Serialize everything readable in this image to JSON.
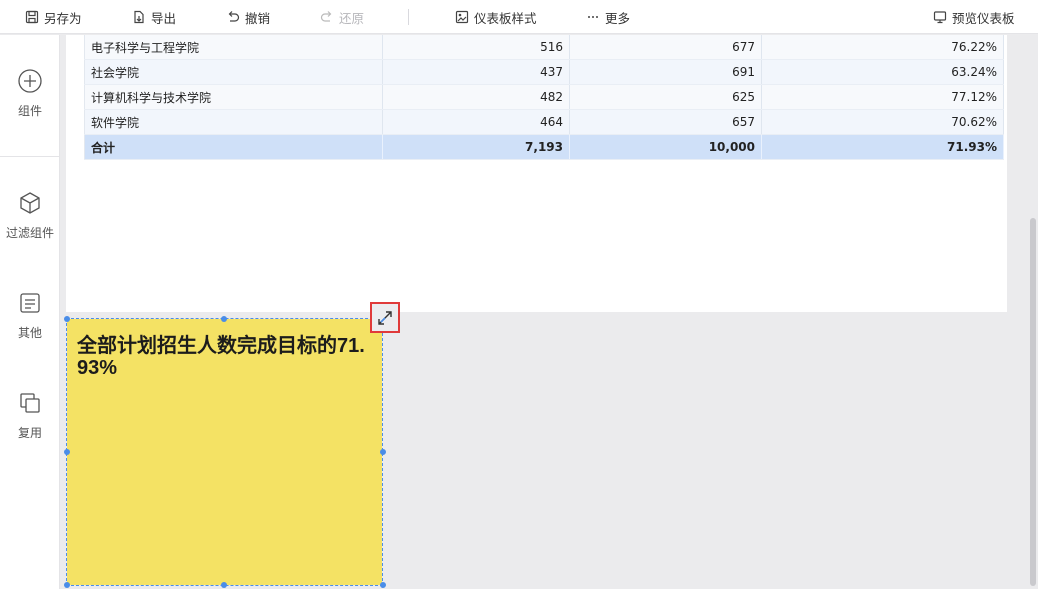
{
  "toolbar": {
    "save_as": "另存为",
    "export": "导出",
    "undo": "撤销",
    "redo": "还原",
    "dashboard_style": "仪表板样式",
    "more": "更多",
    "preview": "预览仪表板"
  },
  "left_panel": {
    "components": "组件",
    "filter_components": "过滤组件",
    "other": "其他",
    "reuse": "复用"
  },
  "table": {
    "rows": [
      {
        "name": "电子科学与工程学院",
        "a": "516",
        "b": "677",
        "c": "76.22%"
      },
      {
        "name": "社会学院",
        "a": "437",
        "b": "691",
        "c": "63.24%"
      },
      {
        "name": "计算机科学与技术学院",
        "a": "482",
        "b": "625",
        "c": "77.12%"
      },
      {
        "name": "软件学院",
        "a": "464",
        "b": "657",
        "c": "70.62%"
      }
    ],
    "total": {
      "name": "合计",
      "a": "7,193",
      "b": "10,000",
      "c": "71.93%"
    }
  },
  "widget": {
    "text": "全部计划招生人数完成目标的71.93%",
    "background": "#f4e264"
  },
  "colors": {
    "accent": "#4a8de8",
    "highlight_border": "#e03a3a",
    "total_row": "#cfe0f8"
  }
}
